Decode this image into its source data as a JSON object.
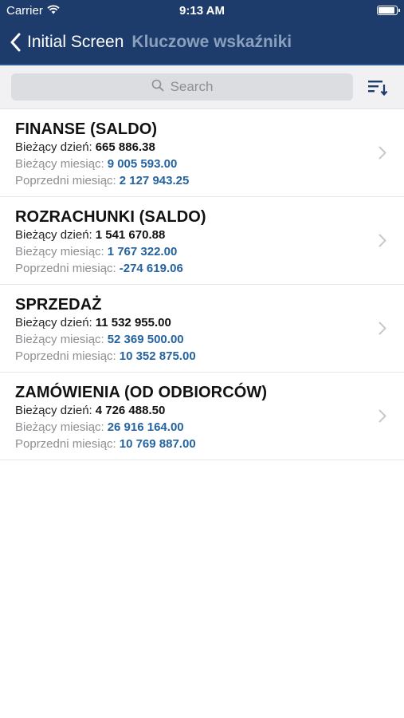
{
  "status_bar": {
    "carrier": "Carrier",
    "time": "9:13 AM"
  },
  "nav": {
    "back_label": "Initial Screen",
    "title": "Kluczowe wskaźniki"
  },
  "search": {
    "placeholder": "Search"
  },
  "labels": {
    "current_day": "Bieżący dzień:",
    "current_month": "Bieżący miesiąc:",
    "previous_month": "Poprzedni miesiąc:"
  },
  "items": [
    {
      "title": "FINANSE (SALDO)",
      "current_day": "665 886.38",
      "current_month": "9 005 593.00",
      "previous_month": "2 127 943.25"
    },
    {
      "title": "ROZRACHUNKI (SALDO)",
      "current_day": "1 541 670.88",
      "current_month": "1 767 322.00",
      "previous_month": "-274 619.06"
    },
    {
      "title": "SPRZEDAŻ",
      "current_day": "11 532 955.00",
      "current_month": "52 369 500.00",
      "previous_month": "10 352 875.00"
    },
    {
      "title": "ZAMÓWIENIA (OD ODBIORCÓW)",
      "current_day": "4 726 488.50",
      "current_month": "26 916 164.00",
      "previous_month": "10 769 887.00"
    }
  ],
  "colors": {
    "nav_background": "#1d3c6b",
    "value_blue": "#2563a0",
    "label_gray": "#8e8e93"
  },
  "icons": {
    "wifi": "wifi-icon",
    "battery": "battery-icon",
    "back": "chevron-left-icon",
    "search": "search-icon",
    "sort": "sort-icon",
    "disclosure": "chevron-right-icon"
  }
}
